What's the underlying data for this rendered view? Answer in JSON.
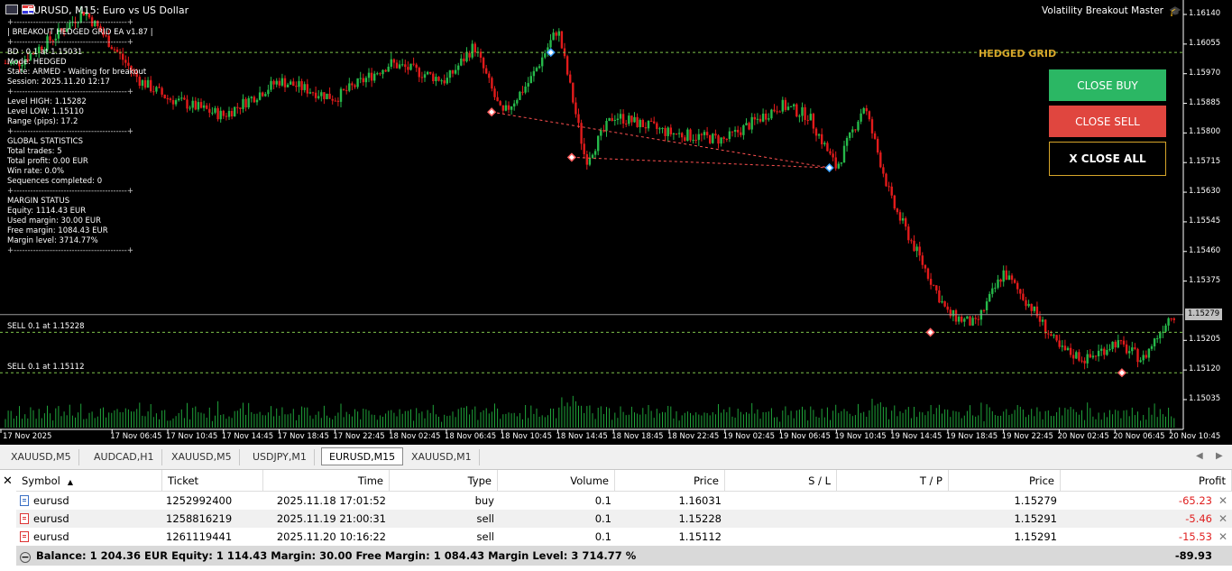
{
  "window": {
    "title": "EURUSD, M15:  Euro vs US Dollar",
    "indicator_title": "Volatility Breakout Master"
  },
  "panel": {
    "lines": [
      {
        "t": "+-----------------------------------------+",
        "sep": true
      },
      {
        "t": "|  BREAKOUT HEDGED GRID EA v1.87           |",
        "sep": false
      },
      {
        "t": "+-----------------------------------------+",
        "sep": true
      },
      {
        "t": "BD : 0.1 at 1.15031",
        "sep": false
      },
      {
        "t": "Mode: HEDGED",
        "sep": false
      },
      {
        "t": "State: ARMED - Waiting for breakout",
        "sep": false
      },
      {
        "t": "Session: 2025.11.20 12:17",
        "sep": false
      },
      {
        "t": "+-----------------------------------------+",
        "sep": true
      },
      {
        "t": "Level HIGH:  1.15282",
        "sep": false
      },
      {
        "t": "Level LOW:    1.15110",
        "sep": false
      },
      {
        "t": "Range (pips): 17.2",
        "sep": false
      },
      {
        "t": "+-----------------------------------------+",
        "sep": true
      },
      {
        "t": "GLOBAL STATISTICS",
        "sep": false
      },
      {
        "t": "Total trades: 5",
        "sep": false
      },
      {
        "t": "Total profit: 0.00 EUR",
        "sep": false
      },
      {
        "t": "Win rate: 0.0%",
        "sep": false
      },
      {
        "t": "Sequences completed: 0",
        "sep": false
      },
      {
        "t": "+-----------------------------------------+",
        "sep": true
      },
      {
        "t": "MARGIN STATUS",
        "sep": false
      },
      {
        "t": "Equity: 1114.43 EUR",
        "sep": false
      },
      {
        "t": "Used margin: 30.00 EUR",
        "sep": false
      },
      {
        "t": "Free margin: 1084.43 EUR",
        "sep": false
      },
      {
        "t": "Margin level: 3714.77%",
        "sep": false
      },
      {
        "t": "+-----------------------------------------+",
        "sep": true
      }
    ]
  },
  "hedged_label": "HEDGED GRID",
  "buttons": {
    "close_buy": "CLOSE BUY",
    "close_sell": "CLOSE SELL",
    "close_all": "X CLOSE ALL"
  },
  "line_labels": {
    "sell1": "SELL 0.1 at 1.15228",
    "sell2": "SELL 0.1 at 1.15112"
  },
  "price_axis": {
    "labels": [
      "1.16140",
      "1.16055",
      "1.15970",
      "1.15885",
      "1.15800",
      "1.15715",
      "1.15630",
      "1.15545",
      "1.15460",
      "1.15375",
      "1.15205",
      "1.15120",
      "1.15035"
    ],
    "current": "1.15279"
  },
  "time_axis": [
    "17 Nov 2025",
    "17 Nov 06:45",
    "17 Nov 10:45",
    "17 Nov 14:45",
    "17 Nov 18:45",
    "17 Nov 22:45",
    "18 Nov 02:45",
    "18 Nov 06:45",
    "18 Nov 10:45",
    "18 Nov 14:45",
    "18 Nov 18:45",
    "18 Nov 22:45",
    "19 Nov 02:45",
    "19 Nov 06:45",
    "19 Nov 10:45",
    "19 Nov 14:45",
    "19 Nov 18:45",
    "19 Nov 22:45",
    "20 Nov 02:45",
    "20 Nov 06:45",
    "20 Nov 10:45"
  ],
  "colors": {
    "bull": "#26b94a",
    "bear": "#e21b1b",
    "volume": "#1fa33a",
    "grid_line": "#7dc24a",
    "gold": "#d6a52a"
  },
  "tabs": [
    "XAUUSD,M5",
    "AUDCAD,H1",
    "XAUUSD,M5",
    "USDJPY,M1",
    "EURUSD,M15",
    "XAUUSD,M1"
  ],
  "active_tab": 4,
  "table": {
    "columns": [
      "Symbol",
      "Ticket",
      "Time",
      "Type",
      "Volume",
      "Price",
      "S / L",
      "T / P",
      "Price",
      "Profit"
    ],
    "rows": [
      {
        "symbol": "eurusd",
        "ticket": "1252992400",
        "time": "2025.11.18 17:01:52",
        "type": "buy",
        "volume": "0.1",
        "price": "1.16031",
        "sl": "",
        "tp": "",
        "cur": "1.15279",
        "profit": "-65.23"
      },
      {
        "symbol": "eurusd",
        "ticket": "1258816219",
        "time": "2025.11.19 21:00:31",
        "type": "sell",
        "volume": "0.1",
        "price": "1.15228",
        "sl": "",
        "tp": "",
        "cur": "1.15291",
        "profit": "-5.46"
      },
      {
        "symbol": "eurusd",
        "ticket": "1261119441",
        "time": "2025.11.20 10:16:22",
        "type": "sell",
        "volume": "0.1",
        "price": "1.15112",
        "sl": "",
        "tp": "",
        "cur": "1.15291",
        "profit": "-15.53"
      }
    ],
    "footer": "Balance: 1 204.36 EUR  Equity: 1 114.43  Margin: 30.00  Free Margin: 1 084.43  Margin Level: 3 714.77 %",
    "total": "-89.93"
  },
  "chart_data": {
    "type": "candlestick",
    "symbol": "EURUSD",
    "timeframe": "M15",
    "ylim": [
      1.15,
      1.1619
    ],
    "y_ticks": [
      1.1614,
      1.16055,
      1.1597,
      1.15885,
      1.158,
      1.15715,
      1.1563,
      1.15545,
      1.1546,
      1.15375,
      1.15205,
      1.1512,
      1.15035
    ],
    "path_x": [
      "17 Nov 2025",
      "17 Nov 02:45",
      "17 Nov 04:45",
      "17 Nov 06:45",
      "17 Nov 08:45",
      "17 Nov 10:45",
      "17 Nov 14:45",
      "17 Nov 18:45",
      "17 Nov 22:45",
      "18 Nov 02:45",
      "18 Nov 06:45",
      "18 Nov 08:45",
      "18 Nov 10:45",
      "18 Nov 12:45",
      "18 Nov 14:45",
      "18 Nov 16:45",
      "18 Nov 18:45",
      "18 Nov 22:45",
      "19 Nov 02:45",
      "19 Nov 06:45",
      "19 Nov 08:45",
      "19 Nov 10:45",
      "19 Nov 12:45",
      "19 Nov 14:45",
      "19 Nov 18:45",
      "19 Nov 20:45",
      "19 Nov 22:45",
      "20 Nov 00:45",
      "20 Nov 02:45",
      "20 Nov 04:45",
      "20 Nov 06:45",
      "20 Nov 08:45",
      "20 Nov 10:45"
    ],
    "path_y": [
      1.16,
      1.1608,
      1.1615,
      1.1605,
      1.1595,
      1.159,
      1.1585,
      1.1595,
      1.159,
      1.16,
      1.1595,
      1.1605,
      1.1585,
      1.1595,
      1.161,
      1.1572,
      1.1585,
      1.158,
      1.1578,
      1.1588,
      1.1585,
      1.157,
      1.1588,
      1.156,
      1.1528,
      1.1525,
      1.154,
      1.153,
      1.1518,
      1.1515,
      1.152,
      1.1515,
      1.1528
    ],
    "hlines": [
      {
        "price": 1.16031,
        "color": "#7dc24a"
      },
      {
        "price": 1.15228,
        "color": "#7dc24a"
      },
      {
        "price": 1.15112,
        "color": "#7dc24a"
      },
      {
        "price": 1.15279,
        "color": "#9a9a9a"
      }
    ],
    "markers": [
      {
        "x": "18 Nov 14:15",
        "price": 1.16031,
        "color": "#3aa0ff"
      },
      {
        "x": "18 Nov 10:00",
        "price": 1.1586,
        "color": "#ff6060"
      },
      {
        "x": "18 Nov 15:45",
        "price": 1.1573,
        "color": "#ff6060"
      },
      {
        "x": "19 Nov 10:15",
        "price": 1.157,
        "color": "#3aa0ff"
      },
      {
        "x": "19 Nov 17:30",
        "price": 1.15228,
        "color": "#ff6060"
      },
      {
        "x": "20 Nov 07:15",
        "price": 1.15112,
        "color": "#ff6060"
      }
    ]
  }
}
